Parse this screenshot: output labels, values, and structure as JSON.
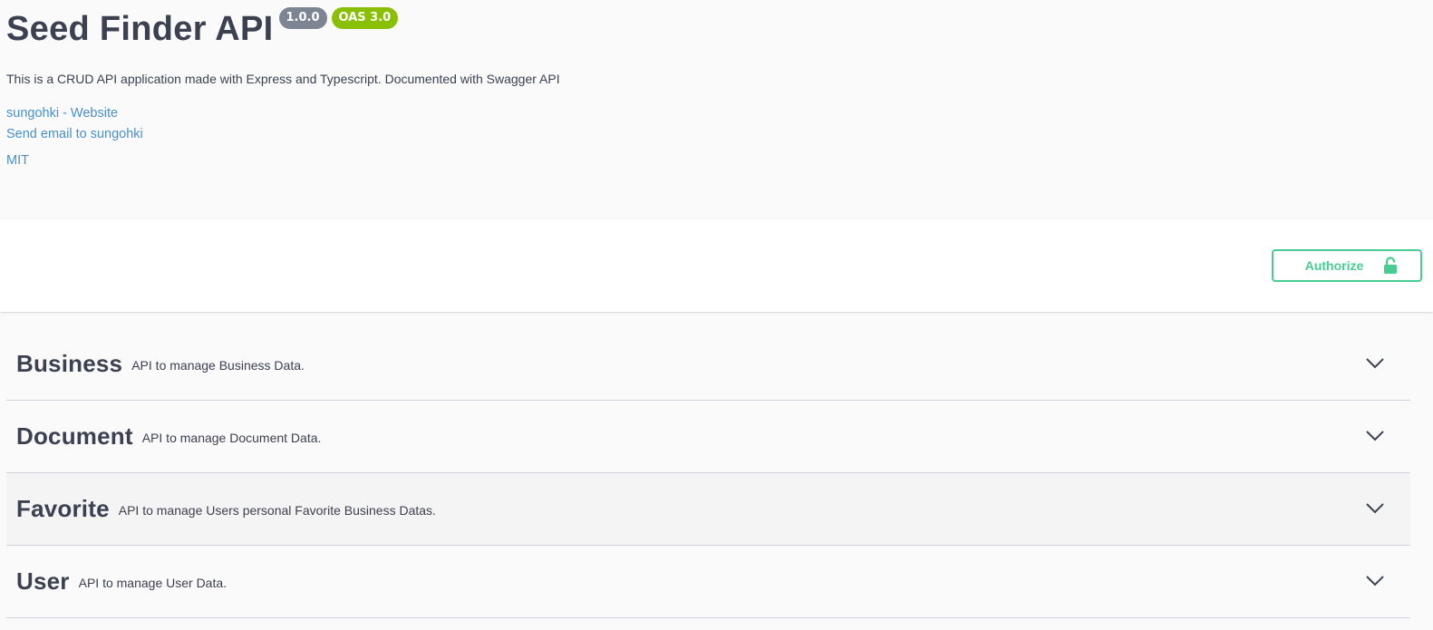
{
  "info": {
    "title": "Seed Finder API",
    "version_badge": "1.0.0",
    "oas_badge": "OAS 3.0",
    "description": "This is a CRUD API application made with Express and Typescript. Documented with Swagger API",
    "contact_website": "sungohki - Website",
    "contact_email": "Send email to sungohki",
    "license": "MIT"
  },
  "scheme": {
    "authorize_label": "Authorize",
    "authorize_icon": "unlocked-padlock-icon"
  },
  "tags": [
    {
      "name": "Business",
      "description": "API to manage Business Data."
    },
    {
      "name": "Document",
      "description": "API to manage Document Data."
    },
    {
      "name": "Favorite",
      "description": "API to manage Users personal Favorite Business Datas."
    },
    {
      "name": "User",
      "description": "API to manage User Data."
    }
  ],
  "colors": {
    "accent_green": "#49cc90",
    "version_badge": "#7d8492",
    "oas_badge": "#89bf04",
    "link": "#4a90c8",
    "text": "#3b4151"
  }
}
